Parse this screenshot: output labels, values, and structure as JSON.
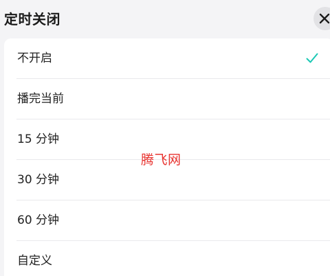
{
  "header": {
    "title": "定时关闭",
    "close_icon": "close-icon"
  },
  "options": [
    {
      "label": "不开启",
      "selected": true
    },
    {
      "label": "播完当前",
      "selected": false
    },
    {
      "label": "15 分钟",
      "selected": false
    },
    {
      "label": "30 分钟",
      "selected": false
    },
    {
      "label": "60 分钟",
      "selected": false
    },
    {
      "label": "自定义",
      "selected": false
    }
  ],
  "watermark": "腾飞网",
  "colors": {
    "accent": "#1ac8b4",
    "watermark": "#e8332f",
    "background": "#f4f4f6"
  }
}
